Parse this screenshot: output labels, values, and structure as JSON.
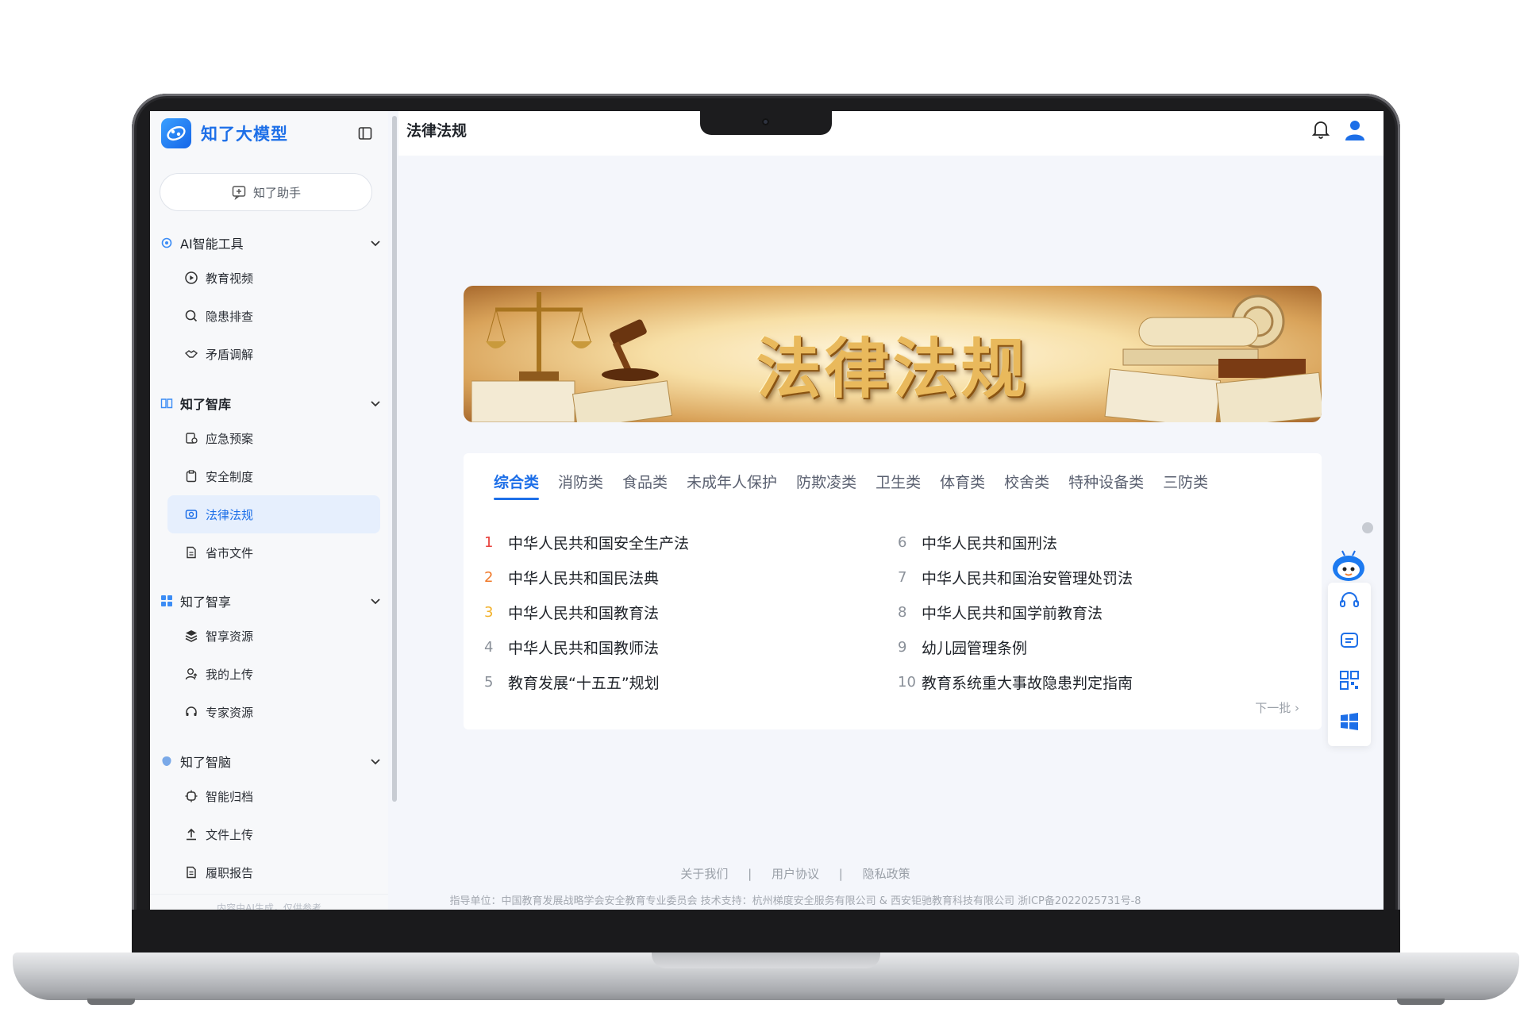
{
  "app": {
    "name": "知了大模型"
  },
  "sidebar": {
    "assistant_label": "知了助手",
    "groups": [
      {
        "title": "AI智能工具",
        "icon": "ai-tools-icon",
        "items": [
          {
            "label": "教育视频",
            "icon": "play-circle-icon"
          },
          {
            "label": "隐患排查",
            "icon": "search-icon"
          },
          {
            "label": "矛盾调解",
            "icon": "handshake-icon"
          }
        ]
      },
      {
        "title": "知了智库",
        "icon": "book-icon",
        "items": [
          {
            "label": "应急预案",
            "icon": "emergency-plan-icon"
          },
          {
            "label": "安全制度",
            "icon": "clipboard-icon"
          },
          {
            "label": "法律法规",
            "icon": "law-icon",
            "active": true
          },
          {
            "label": "省市文件",
            "icon": "file-icon"
          }
        ]
      },
      {
        "title": "知了智享",
        "icon": "grid-icon",
        "items": [
          {
            "label": "智享资源",
            "icon": "layers-icon"
          },
          {
            "label": "我的上传",
            "icon": "user-upload-icon"
          },
          {
            "label": "专家资源",
            "icon": "headset-icon"
          }
        ]
      },
      {
        "title": "知了智脑",
        "icon": "brain-icon",
        "items": [
          {
            "label": "智能归档",
            "icon": "chip-icon"
          },
          {
            "label": "文件上传",
            "icon": "upload-icon"
          },
          {
            "label": "履职报告",
            "icon": "report-icon"
          }
        ]
      }
    ],
    "footnote": "内容由AI生成，仅供参考"
  },
  "header": {
    "title": "法律法规"
  },
  "banner": {
    "title": "法律法规"
  },
  "tabs": [
    "综合类",
    "消防类",
    "食品类",
    "未成年人保护",
    "防欺凌类",
    "卫生类",
    "体育类",
    "校舍类",
    "特种设备类",
    "三防类"
  ],
  "active_tab": 0,
  "laws": [
    {
      "num": "1",
      "title": "中华人民共和国安全生产法",
      "color": "#e8403c"
    },
    {
      "num": "2",
      "title": "中华人民共和国民法典",
      "color": "#f07a2b"
    },
    {
      "num": "3",
      "title": "中华人民共和国教育法",
      "color": "#f2b12b"
    },
    {
      "num": "4",
      "title": "中华人民共和国教师法",
      "color": "#8a9099"
    },
    {
      "num": "5",
      "title": "教育发展“十五五”规划",
      "color": "#8a9099"
    },
    {
      "num": "6",
      "title": "中华人民共和国刑法",
      "color": "#8a9099"
    },
    {
      "num": "7",
      "title": "中华人民共和国治安管理处罚法",
      "color": "#8a9099"
    },
    {
      "num": "8",
      "title": "中华人民共和国学前教育法",
      "color": "#8a9099"
    },
    {
      "num": "9",
      "title": "幼儿园管理条例",
      "color": "#8a9099"
    },
    {
      "num": "10",
      "title": "教育系统重大事故隐患判定指南",
      "color": "#8a9099"
    }
  ],
  "more_label": "下一批",
  "footer": {
    "links": [
      "关于我们",
      "用户协议",
      "隐私政策"
    ],
    "separator": "|",
    "info": "指导单位：中国教育发展战略学会安全教育专业委员会   技术支持：杭州梯度安全服务有限公司 & 西安钜驰教育科技有限公司   浙ICP备2022025731号-8"
  },
  "colors": {
    "accent": "#1d6fe8",
    "active_bg": "#e6effd"
  }
}
